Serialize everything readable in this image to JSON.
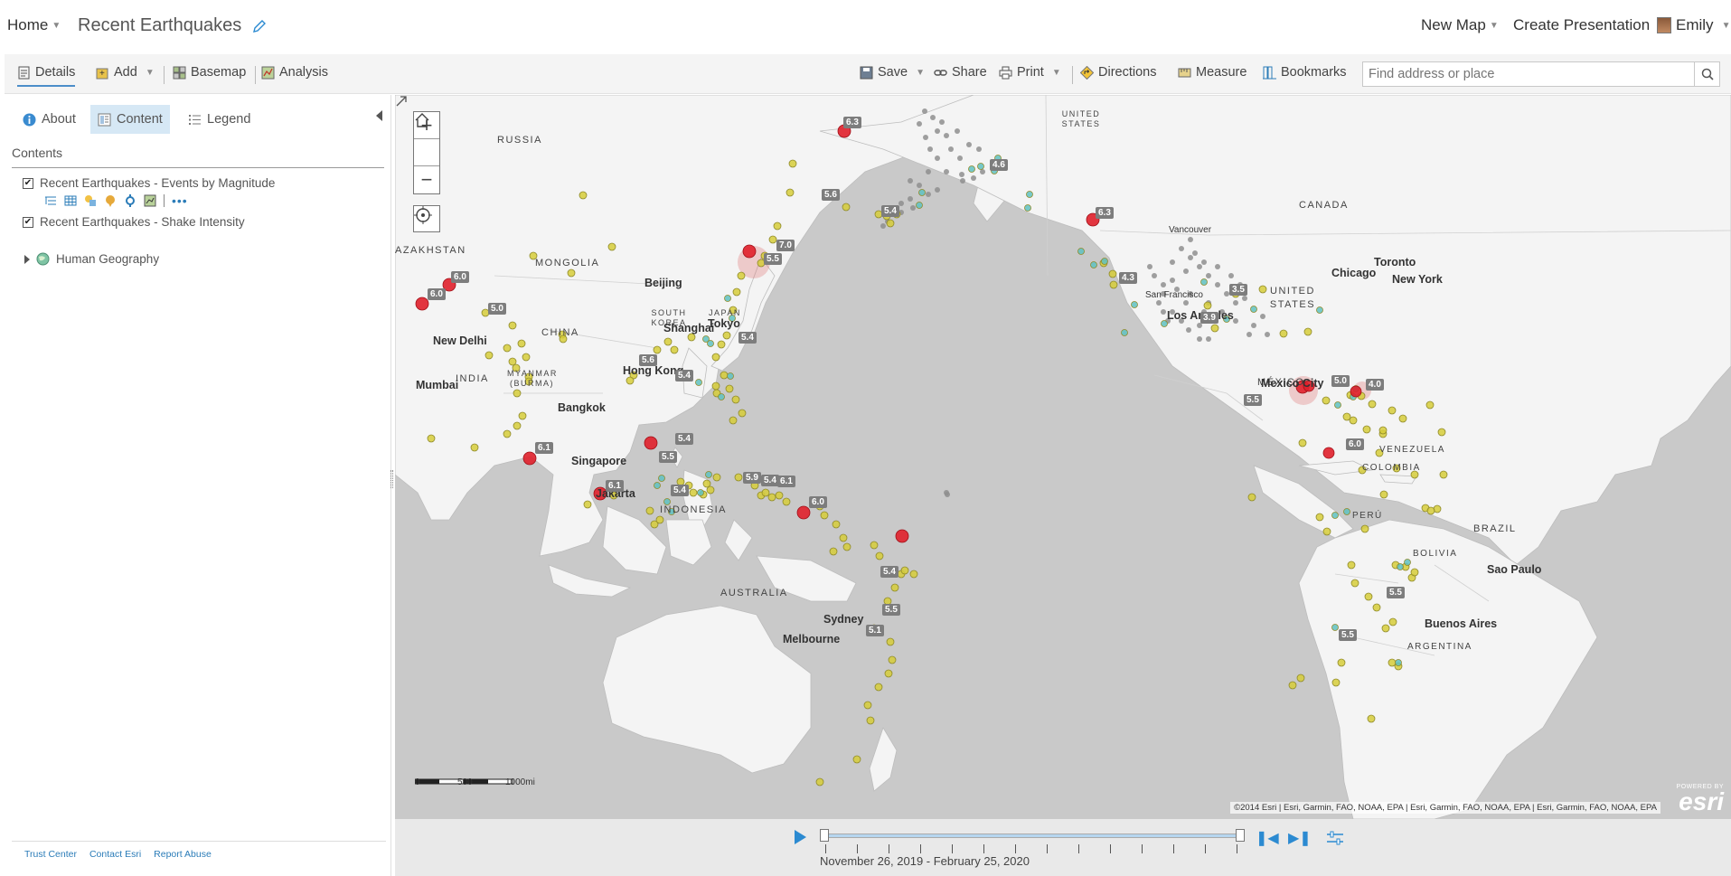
{
  "header": {
    "home_label": "Home",
    "title": "Recent Earthquakes",
    "new_map_label": "New Map",
    "create_presentation_label": "Create Presentation",
    "user_name": "Emily"
  },
  "toolbar": {
    "details_label": "Details",
    "add_label": "Add",
    "basemap_label": "Basemap",
    "analysis_label": "Analysis",
    "save_label": "Save",
    "share_label": "Share",
    "print_label": "Print",
    "directions_label": "Directions",
    "measure_label": "Measure",
    "bookmarks_label": "Bookmarks",
    "search_placeholder": "Find address or place"
  },
  "panel": {
    "tabs": [
      {
        "label": "About",
        "active": false
      },
      {
        "label": "Content",
        "active": true
      },
      {
        "label": "Legend",
        "active": false
      }
    ],
    "contents_heading": "Contents",
    "layers": [
      {
        "label": "Recent Earthquakes - Events by Magnitude",
        "checked": true
      },
      {
        "label": "Recent Earthquakes - Shake Intensity",
        "checked": true
      }
    ],
    "group_layer": "Human Geography",
    "footer": [
      "Trust Center",
      "Contact Esri",
      "Report Abuse"
    ]
  },
  "map": {
    "labels": {
      "russia": "RUSSIA",
      "kazakhstan": "AZAKHSTAN",
      "mongolia": "MONGOLIA",
      "china": "CHINA",
      "india": "INDIA",
      "myanmar": "MYANMAR (BURMA)",
      "south_korea": "SOUTH KOREA",
      "japan": "JAPAN",
      "indonesia": "INDONESIA",
      "australia": "AUSTRALIA",
      "united_states_north": "UNITED STATES",
      "canada": "CANADA",
      "united_states": "UNITED STATES",
      "mexico": "MÉXICO",
      "venezuela": "VENEZUELA",
      "colombia": "COLOMBIA",
      "peru": "PERÚ",
      "brasil": "BRAZIL",
      "bolivia": "BOLIVIA",
      "argentina": "ARGENTINA",
      "beijing": "Beijing",
      "shanghai": "Shanghai",
      "tokyo": "Tokyo",
      "hong_kong": "Hong Kong",
      "new_delhi": "New Delhi",
      "mumbai": "Mumbai",
      "bangkok": "Bangkok",
      "singapore": "Singapore",
      "jakarta": "Jakarta",
      "sydney": "Sydney",
      "melbourne": "Melbourne",
      "vancouver": "Vancouver",
      "san_francisco": "San Francisco",
      "los_angeles": "Los Angeles",
      "chicago": "Chicago",
      "toronto": "Toronto",
      "new_york": "New York",
      "mexico_city": "Mexico City",
      "sao_paulo": "Sao Paulo",
      "buenos_aires": "Buenos Aires"
    },
    "magnitude_labels": [
      "6.3",
      "5.6",
      "5.4",
      "7.0",
      "5.5",
      "6.0",
      "6.0",
      "5.0",
      "5.4",
      "5.6",
      "5.4",
      "6.1",
      "5.4",
      "5.5",
      "6.1",
      "5.4",
      "5.9",
      "5.4",
      "6.1",
      "6.0",
      "5.4",
      "5.5",
      "5.1",
      "6.3",
      "4.6",
      "4.3",
      "3.5",
      "3.9",
      "5.5",
      "5.0",
      "4.0",
      "6.0",
      "5.5",
      "5.5"
    ],
    "scale": {
      "zero": "0",
      "mid": "500",
      "max": "1000mi"
    },
    "attribution": "©2014 Esri | Esri, Garmin, FAO, NOAA, EPA | Esri, Garmin, FAO, NOAA, EPA | Esri, Garmin, FAO, NOAA, EPA",
    "esri_powered": "POWERED BY",
    "esri_logo": "esri"
  },
  "time_slider": {
    "range": "November 26, 2019 - February 25, 2020"
  },
  "colors": {
    "accent": "#2b8ad1",
    "land": "#f4f4f4",
    "water": "#c9c9c9",
    "quake_major": "#e0202b",
    "quake_minor": "#d6cc3a",
    "quake_shallow": "#5fc1c1"
  }
}
